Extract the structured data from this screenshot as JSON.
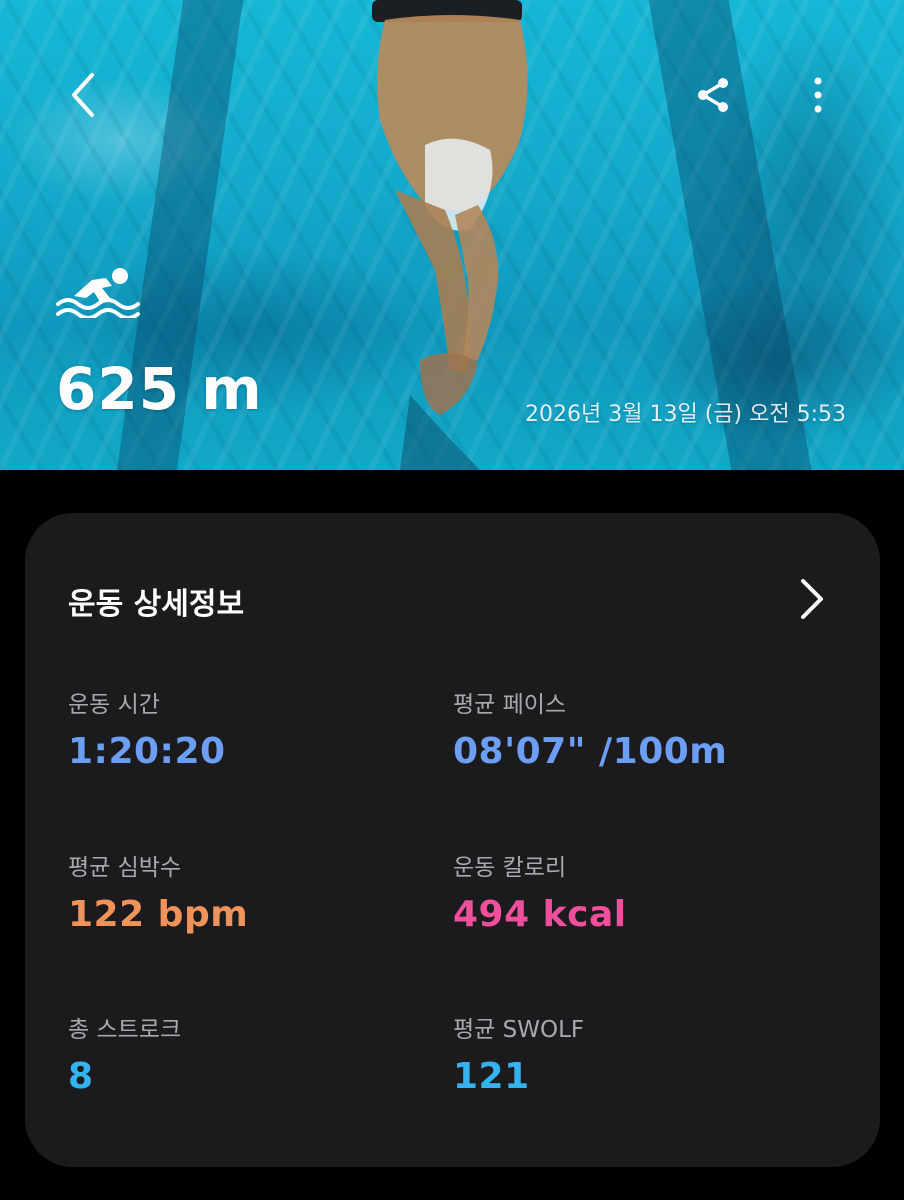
{
  "header": {
    "distance": "625 m",
    "datetime": "2026년 3월 13일 (금) 오전 5:53",
    "icons": [
      "back-arrow-icon",
      "share-icon",
      "more-vertical-icon",
      "swimming-icon"
    ]
  },
  "details": {
    "title": "운동 상세정보",
    "metrics": [
      {
        "label": "운동 시간",
        "value": "1:20:20",
        "color": "#6d9ef5"
      },
      {
        "label": "평균 페이스",
        "value": "08'07\" /100m",
        "color": "#6d9ef5"
      },
      {
        "label": "평균 심박수",
        "value": "122 bpm",
        "color": "#f0935a"
      },
      {
        "label": "운동 칼로리",
        "value": "494 kcal",
        "color": "#f04f9c"
      },
      {
        "label": "총 스트로크",
        "value": "8",
        "color": "#34b3f1"
      },
      {
        "label": "평균 SWOLF",
        "value": "121",
        "color": "#34b3f1"
      }
    ]
  }
}
